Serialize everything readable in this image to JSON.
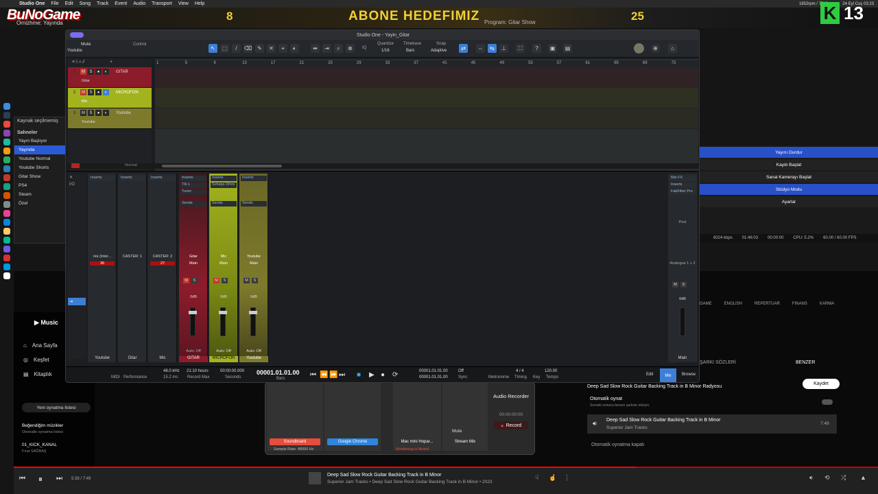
{
  "menubar": {
    "app": "Studio One",
    "items": [
      "File",
      "Edit",
      "Song",
      "Track",
      "Event",
      "Audio",
      "Transport",
      "View",
      "Help"
    ],
    "status_stats": "1852rpm / 75°C",
    "clock": "24 Eyl Cuş 03:23"
  },
  "banner": {
    "logo": "BuNoGame",
    "logo_sub": "Ornizhme: Yayında",
    "goal_current": "8",
    "goal_title": "ABONE HEDEFIMIZ",
    "goal_target": "25",
    "program": "Program: Gitar Show",
    "badge_letter": "K",
    "badge_number": "13"
  },
  "obs": {
    "source_label": "Kaynak seçilmemiş",
    "scenes_header": "Sahneler",
    "scenes": [
      "Yayın Başlıyor",
      "Yayında",
      "Youtube Normal",
      "Youtube Shorts",
      "Gitar Show",
      "PS4",
      "Steam",
      "Özel"
    ],
    "selected_scene": "Yayında",
    "controls": [
      "Yayını Durdur",
      "Kaydı Başlat",
      "Sanal Kamerayı Başlat",
      "Stüdyo Modu",
      "Ayarlar"
    ],
    "status": {
      "bitrate": "6024 kbps",
      "live_time": "01:46:03",
      "rec_time": "00:00:00",
      "cpu": "CPU: 5.2%",
      "fps": "60.00 / 60.00 FPS"
    }
  },
  "studio": {
    "title": "Studio One - Yayin_Gitar",
    "toolbar": {
      "device": "Youtube",
      "mute": "Mute",
      "control": "Control",
      "quantize_label": "Quantize",
      "quantize_value": "1/16",
      "timebase_label": "Timebase",
      "timebase_value": "Bars",
      "snap_label": "Snap",
      "snap_value": "Adaptive"
    },
    "ruler": [
      "1",
      "5",
      "9",
      "13",
      "17",
      "21",
      "25",
      "29",
      "33",
      "37",
      "41",
      "45",
      "49",
      "53",
      "57",
      "61",
      "65",
      "69",
      "73"
    ],
    "tracks": [
      {
        "num": "1",
        "name": "GITAR",
        "input": "Gitar",
        "color": "#8d1c2b"
      },
      {
        "num": "2",
        "name": "MICROFON",
        "input": "Mic",
        "color": "#a3b31e"
      },
      {
        "num": "3",
        "name": "Youtube",
        "input": "Youtube",
        "color": "#7d7a2c"
      }
    ],
    "mode": "Normal",
    "mixer": {
      "inputs": [
        {
          "name": "n/a (Inter...",
          "value": "36",
          "bottom": "Youtube"
        },
        {
          "name": "CASTER: 1",
          "value": "",
          "bottom": "Gitar"
        },
        {
          "name": "CASTER: 2",
          "value": "27",
          "bottom": "Mic"
        }
      ],
      "channels": [
        {
          "name": "Gitar",
          "route": "Main",
          "db": "0dB",
          "label": "GITAR",
          "insert1": "Inserts",
          "insert2": "TR-1",
          "insert3": "Tuner",
          "color": "#8d1c2b"
        },
        {
          "name": "Mic",
          "route": "Main",
          "db": "0dB",
          "label": "MICROFON",
          "insert1": "Inserts",
          "insert2": "Scheps Omni",
          "insert3": "",
          "color": "#a3b31e"
        },
        {
          "name": "Youtube",
          "route": "Main",
          "db": "0dB",
          "label": "Youtube",
          "insert1": "Inserts",
          "insert2": "",
          "insert3": "",
          "color": "#7d7a2c"
        }
      ],
      "sends": "Sends",
      "auto": "Auto: Off",
      "main": {
        "label": "Main",
        "fx": "Mix FX",
        "insert": "Inserts",
        "plugin": "FabFilter Pro",
        "post": "Post",
        "output": "Analogue 1 + 2",
        "db": "0dB"
      }
    },
    "transport": {
      "sample_rate": "48.0 kHz",
      "latency": "15.2 ms",
      "record_max": "21:10 hours",
      "record_max_label": "Record Max",
      "seconds": "00:00:00.000",
      "seconds_label": "Seconds",
      "position": "00001.01.01.00",
      "bars_label": "Bars",
      "loop_start": "00001.01.01.00",
      "loop_end": "00001.01.01.00",
      "sync": "Off",
      "sig": "4 / 4",
      "timing_label": "Timing",
      "key_label": "Key",
      "tempo": "120.00",
      "tempo_label": "Tempo",
      "midi": "MIDI",
      "performance": "Performance",
      "metronome": "Metronome",
      "sync_label": "Sync",
      "edit": "Edit",
      "mix": "Mix",
      "browse": "Browse"
    }
  },
  "audio_panel": {
    "channels": [
      "Soundboard",
      "Google Chrome",
      "Mac mini Hopar...",
      "Stream Mix"
    ],
    "sample_rate": "Sample Rate: 48000 Hz",
    "monitoring": "Monitoring is Muted",
    "mute": "Mute",
    "recorder_title": "Audio Recorder",
    "rec_time": "00:00:00:00",
    "record": "Record"
  },
  "ytm": {
    "tabs": [
      "GAME",
      "ENGLISH",
      "REPERTUAR",
      "FINANS",
      "KARMA"
    ],
    "nav": [
      "Ana Sayfa",
      "Keşfet",
      "Kitaplık"
    ],
    "new_playlist": "Yeni oynatma listesi",
    "liked": "Beğendiğim müzikler",
    "liked_sub": "Otomatik oynatma listesi",
    "pl2": "01_KICK_KANAL",
    "pl2_sub": "Fırat SAĞBAŞ",
    "lyrics": "ŞARKI SÖZLERİ",
    "similar": "BENZER",
    "radio": "Deep Sad Slow Rock Guitar Backing Track in B Minor Radyosu",
    "save": "Kaydet",
    "autoplay": "Otomatik oynat",
    "autoplay_sub": "Sonraki sonunu benzer şarkılar ekleyin.",
    "queue_title": "Deep Sad Slow Rock Guitar Backing Track in B Minor",
    "queue_artist": "Superior Jam Tracks",
    "queue_dur": "7:49",
    "autoplay_off": "Otomatik oynatma kapalı",
    "player": {
      "time": "5:38 / 7:49",
      "title": "Deep Sad Slow Rock Guitar Backing Track in B Minor",
      "sub": "Superior Jam Tracks • Deep Sad Slow Rock Guitar Backing Track in B Minor • 2023",
      "progress": 0.72
    }
  }
}
